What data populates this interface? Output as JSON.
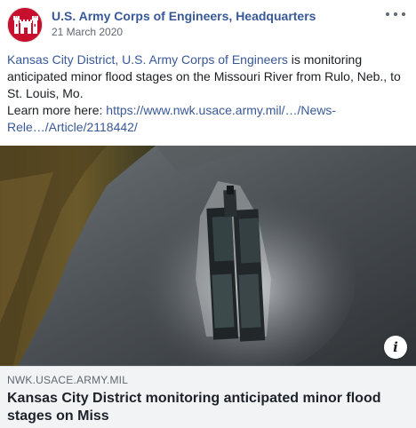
{
  "post": {
    "page_name": "U.S. Army Corps of Engineers, Headquarters",
    "date": "21 March 2020",
    "text": {
      "mention": "Kansas City District, U.S. Army Corps of Engineers",
      "body": " is monitoring anticipated minor flood stages on the Missouri River from Rulo, Neb., to St. Louis, Mo.",
      "learn_more": "Learn more here: ",
      "link": "https://www.nwk.usace.army.mil/…/News-Rele…/Article/2118442/"
    }
  },
  "link_preview": {
    "domain": "NWK.USACE.ARMY.MIL",
    "title": "Kansas City District monitoring anticipated minor flood stages on Miss",
    "info_icon": "i"
  },
  "colors": {
    "link_blue": "#385898",
    "text": "#1c1e21",
    "muted": "#606770",
    "caption_bg": "#f2f3f5",
    "brand_red": "#c8102e"
  }
}
